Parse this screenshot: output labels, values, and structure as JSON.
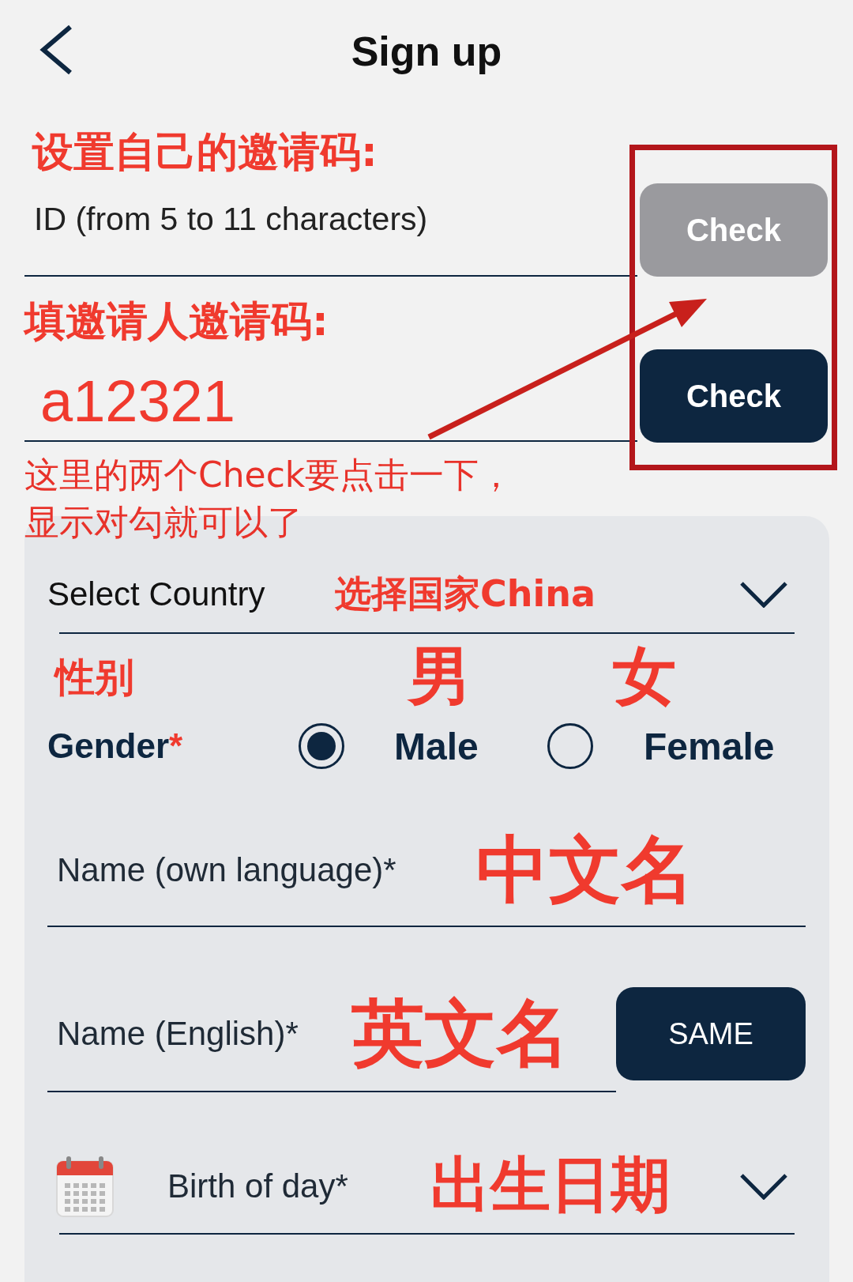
{
  "header": {
    "title": "Sign up"
  },
  "own_code": {
    "annotation": "设置自己的邀请码:",
    "placeholder": "ID (from 5 to 11 characters)",
    "button": {
      "label": "Check",
      "disabled": true
    }
  },
  "inviter_code": {
    "annotation": "填邀请人邀请码:",
    "value": "a12321",
    "button": {
      "label": "Check",
      "disabled": false
    }
  },
  "note": [
    "这里的两个Check要点击一下，",
    "显示对勾就可以了"
  ],
  "country": {
    "label": "Select Country",
    "annotation": "选择国家China"
  },
  "gender": {
    "annotation": "性别",
    "label": "Gender",
    "required_mark": "*",
    "options": [
      {
        "label": "Male",
        "annotation": "男",
        "selected": true
      },
      {
        "label": "Female",
        "annotation": "女",
        "selected": false
      }
    ]
  },
  "name_own": {
    "placeholder": "Name (own language)*",
    "annotation": "中文名"
  },
  "name_english": {
    "placeholder": "Name (English)*",
    "annotation": "英文名",
    "button": "SAME"
  },
  "birthday": {
    "placeholder": "Birth of day*",
    "annotation": "出生日期"
  }
}
